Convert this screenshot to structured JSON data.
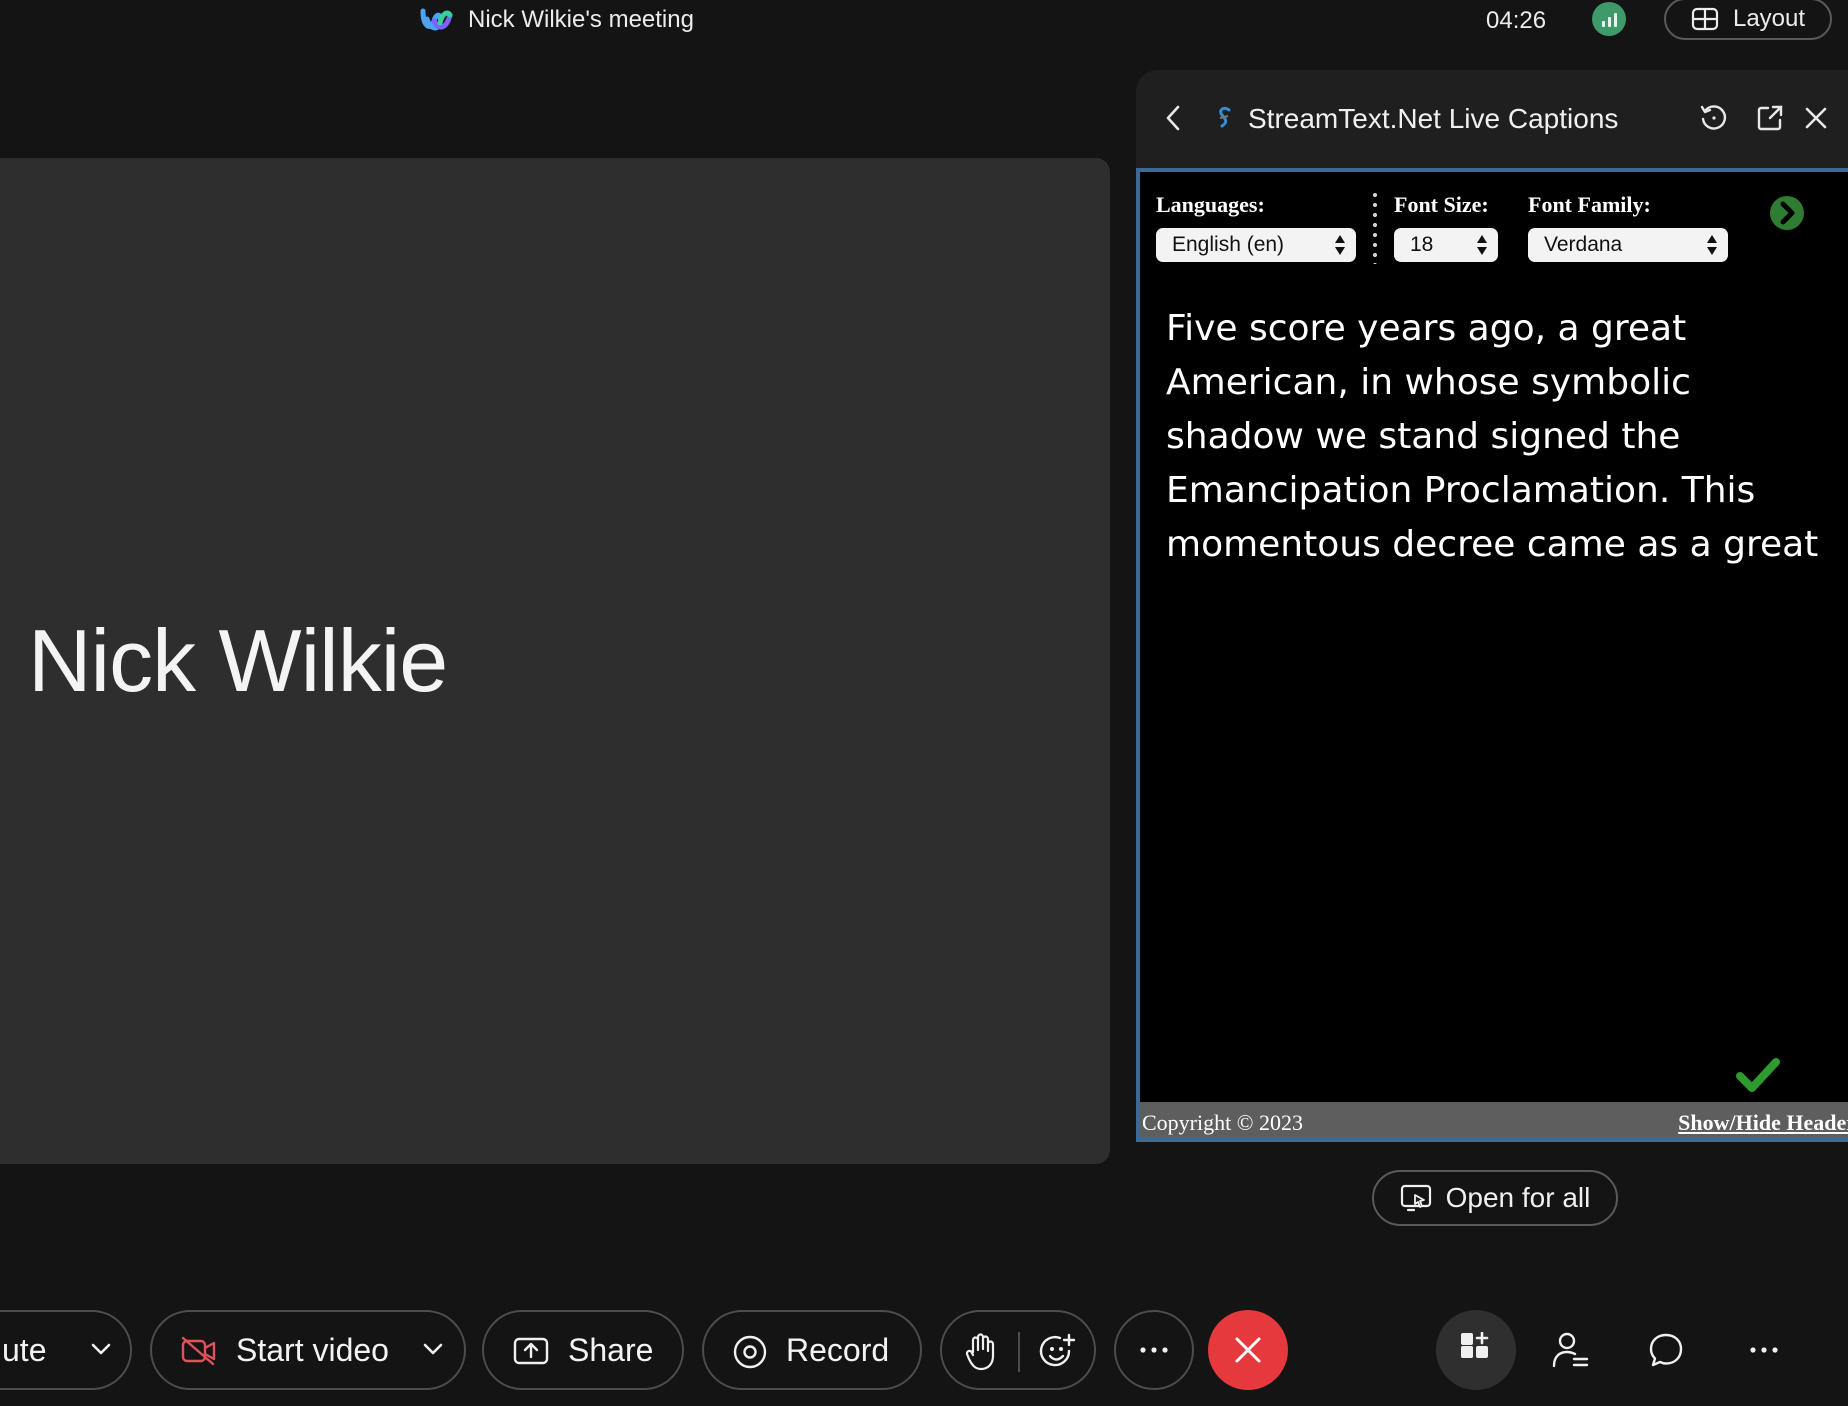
{
  "topbar": {
    "meeting_title": "Nick Wilkie's meeting",
    "timer": "04:26",
    "layout_label": "Layout"
  },
  "video": {
    "participant_name": "Nick Wilkie"
  },
  "panel": {
    "title": "StreamText.Net Live Captions",
    "captions": {
      "languages_label": "Languages:",
      "language_value": "English (en)",
      "font_size_label": "Font Size:",
      "font_size_value": "18",
      "font_family_label": "Font Family:",
      "font_family_value": "Verdana",
      "caption_text": "Five score years ago, a great\nAmerican, in whose symbolic\nshadow we stand signed the\nEmancipation Proclamation. This\nmomentous decree came as a great",
      "copyright": "Copyright © 2023",
      "show_hide_header": "Show/Hide Header"
    },
    "open_for_all_label": "Open for all"
  },
  "toolbar": {
    "mute_label": "ute",
    "start_video_label": "Start video",
    "share_label": "Share",
    "record_label": "Record"
  },
  "colors": {
    "background": "#141414",
    "video_tile": "#2e2e2e",
    "panel_frame_border": "#3d6a95",
    "end_call": "#e5393d",
    "signal_green": "#3f9a6b",
    "status_check_green": "#2e9b2e",
    "video_off_red": "#e0525a"
  },
  "icons": [
    "webex-logo-icon",
    "signal-strength-icon",
    "layout-grid-icon",
    "back-chevron-icon",
    "streamtext-logo-icon",
    "refresh-icon",
    "popout-icon",
    "close-icon",
    "go-arrow-icon",
    "checkmark-icon",
    "share-screen-icon",
    "chevron-down-icon",
    "video-off-icon",
    "share-icon",
    "record-icon",
    "raise-hand-icon",
    "reactions-icon",
    "more-icon",
    "end-call-icon",
    "apps-icon",
    "participants-icon",
    "chat-icon"
  ]
}
